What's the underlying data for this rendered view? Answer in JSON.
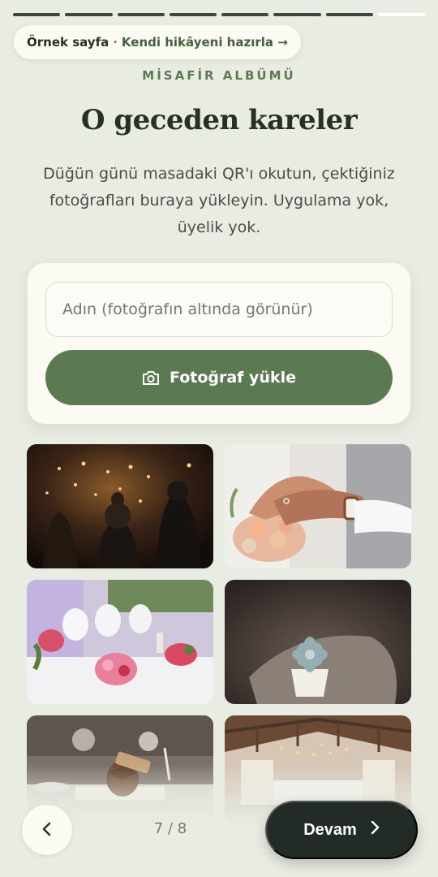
{
  "progress": {
    "total_steps": 8,
    "current_step": 7
  },
  "sample_banner": {
    "label": "Örnek sayfa",
    "separator": "·",
    "link": "Kendi hikâyeni hazırla →"
  },
  "hero": {
    "eyebrow": "MİSAFİR ALBÜMÜ",
    "title": "O geceden kareler",
    "description": "Düğün günü masadaki QR'ı okutun, çektiğiniz fotoğrafları buraya yükleyin. Uygulama yok, üyelik yok."
  },
  "upload_card": {
    "name_placeholder": "Adın (fotoğrafın altında görünür)",
    "upload_label": "Fotoğraf yükle",
    "upload_icon": "camera-icon"
  },
  "photos": [
    {
      "subject": "sparkler-send-off"
    },
    {
      "subject": "hands-with-rings-and-bouquet"
    },
    {
      "subject": "reception-table-with-flowers"
    },
    {
      "subject": "succulent-in-pot"
    },
    {
      "subject": "pinecone-place-card"
    },
    {
      "subject": "rustic-barn-venue"
    }
  ],
  "footer": {
    "back_icon": "chevron-left-icon",
    "pager": "7 / 8",
    "next_label": "Devam",
    "next_icon": "chevron-right-icon"
  },
  "colors": {
    "background": "#e9ece3",
    "accent_green": "#5c7a51",
    "dark_button": "#222b25",
    "card": "#fbfaf3"
  }
}
